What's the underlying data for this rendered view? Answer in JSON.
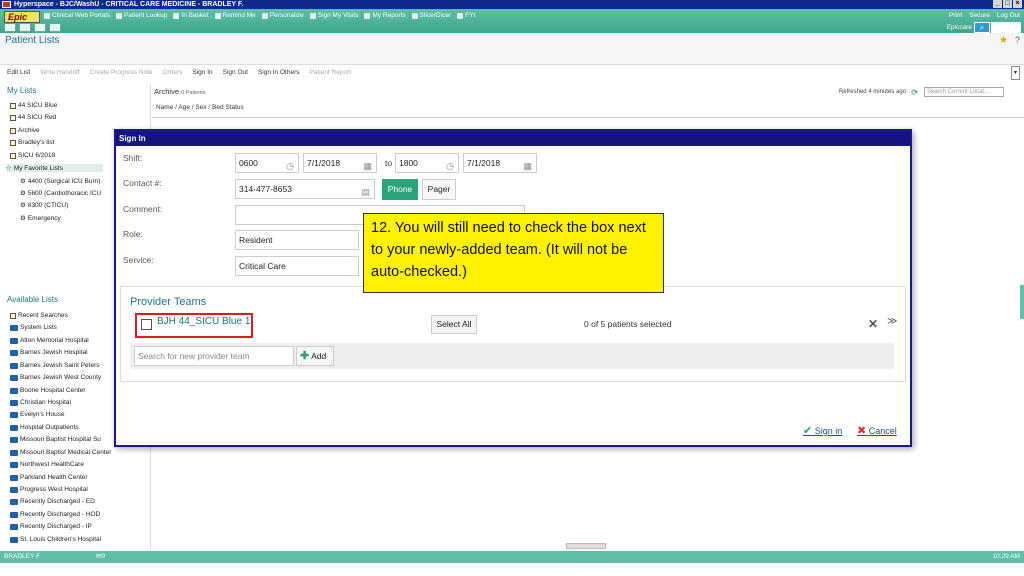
{
  "window": {
    "title": "Hyperspace - BJC/WashU - CRITICAL CARE MEDICINE - BRADLEY F."
  },
  "toolbar": {
    "epic": "Epic",
    "menu": [
      "Clinical Web Portals",
      "Patient Lookup",
      "In Basket",
      "Remind Me",
      "Personalize",
      "Sign My Visits",
      "My Reports",
      "SlicerDicer",
      "FYI"
    ],
    "right": [
      "Print",
      "Secure",
      "Log Out"
    ],
    "epiccare": "Epiccare"
  },
  "page": {
    "title": "Patient Lists"
  },
  "actions": [
    "Edit List",
    "Write Handoff",
    "Create Progress Note",
    "Orders",
    "Sign In",
    "Sign Out",
    "Sign In Others",
    "Patient Report"
  ],
  "sidebar": {
    "my_lists_title": "My Lists",
    "my_lists": [
      "44 SICU Blue",
      "44 SICU Red",
      "Archive",
      "Bradley's list",
      "SICU 6/2018",
      "My Favorite Lists",
      "4400 (Surgical ICU Burn)",
      "5600 (Cardiothoracic ICU",
      "8300 (CTICU)",
      "Emergency"
    ],
    "available_title": "Available Lists",
    "available": [
      "Recent Searches",
      "System Lists",
      "Alton Memorial Hospital",
      "Barnes Jewish Hospital",
      "Barnes Jewish Saint Peters",
      "Barnes Jewish West County",
      "Boone Hospital Center",
      "Christian Hospital",
      "Evelyn's House",
      "Hospital Outpatients",
      "Missouri Baptist Hospital Su",
      "Missouri Baptist Medical Center",
      "Northwest HealthCare",
      "Parkland Health Center",
      "Progress West Hospital",
      "Recently Discharged - ED",
      "Recently Discharged - HOD",
      "Recently Discharged - IP",
      "St. Louis Children's Hospital"
    ]
  },
  "main": {
    "archive": "Archive",
    "patients": "0 Patients",
    "refreshed": "Refreshed 4 minutes ago",
    "search_placeholder": "Search Current Locat...",
    "column_header": "Name / Age / Sex / Bed Status"
  },
  "dialog": {
    "title": "Sign In",
    "labels": {
      "shift": "Shift:",
      "contact": "Contact #:",
      "comment": "Comment:",
      "role": "Role:",
      "service": "Service:"
    },
    "shift": {
      "start_time": "0600",
      "start_date": "7/1/2018",
      "to": "to",
      "end_time": "1800",
      "end_date": "7/1/2018"
    },
    "contact": "314-477-8653",
    "phone": "Phone",
    "pager": "Pager",
    "comment": "",
    "role": "Resident",
    "service": "Critical Care",
    "provider_teams_title": "Provider Teams",
    "team_label": "BJH 44_SICU Blue 1",
    "select_all": "Select All",
    "selected_count": "0 of 5 patients selected",
    "search_team_placeholder": "Search for new provider team",
    "add": "Add",
    "sign_in": "Sign in",
    "cancel": "Cancel"
  },
  "callout": {
    "text": "12. You will still need to check the box next to your newly-added team. (It will not be auto-checked.)"
  },
  "status": {
    "user": "BRADLEY F",
    "mail": "0",
    "time": "10:29 AM"
  }
}
